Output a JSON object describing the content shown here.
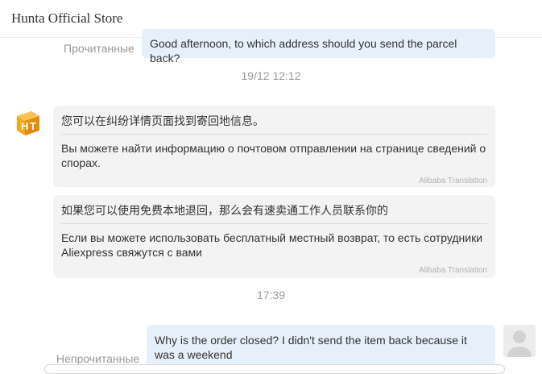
{
  "header": {
    "store_name": "Hunta Official Store"
  },
  "messages": {
    "m1": {
      "status": "Прочитанные",
      "text": "Good afternoon, to which address should you send the parcel back?"
    },
    "ts1": "19/12 12:12",
    "m2": {
      "original": "您可以在纠纷详情页面找到寄回地信息。",
      "translation": "Вы можете найти информацию о почтовом отправлении на странице сведений о спорах.",
      "source": "Alibaba Translation"
    },
    "m3": {
      "original": "如果您可以使用免费本地退回，那么会有速卖通工作人员联系你的",
      "translation": "Если вы можете использовать бесплатный местный возврат, то есть сотрудники Aliexpress свяжутся с вами",
      "source": "Alibaba Translation"
    },
    "ts2": "17:39",
    "m4": {
      "status": "Непрочитанные",
      "text": "Why is the order closed? I didn't send the item back because it was a weekend"
    }
  },
  "icons": {
    "store_avatar": "store-logo-icon",
    "user_avatar": "user-avatar-icon"
  },
  "colors": {
    "outgoing_bubble": "#e6f0fb",
    "incoming_bubble": "#f3f3f3",
    "store_logo": "#f5a623"
  }
}
